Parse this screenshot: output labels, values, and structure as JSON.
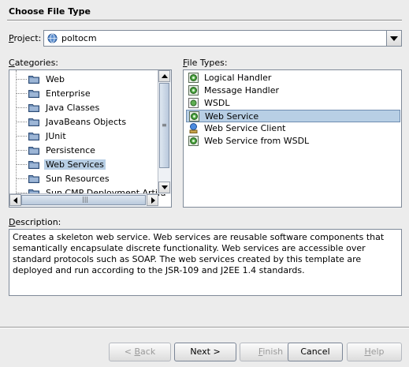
{
  "dialog": {
    "section_title": "Choose File Type"
  },
  "project": {
    "label_prefix": "",
    "label_underlined": "P",
    "label_rest": "roject:",
    "value": "poltocm"
  },
  "categories": {
    "label_underlined": "C",
    "label_rest": "ategories:",
    "items": [
      {
        "label": "Web"
      },
      {
        "label": "Enterprise"
      },
      {
        "label": "Java Classes"
      },
      {
        "label": "JavaBeans Objects"
      },
      {
        "label": "JUnit"
      },
      {
        "label": "Persistence"
      },
      {
        "label": "Web Services"
      },
      {
        "label": "Sun Resources"
      },
      {
        "label": "Sun CMP Deployment Artifa"
      }
    ],
    "selected": "Web Services"
  },
  "file_types": {
    "label_underlined": "F",
    "label_rest": "ile Types:",
    "items": [
      {
        "label": "Logical Handler",
        "icon": "handler-icon"
      },
      {
        "label": "Message Handler",
        "icon": "handler-icon"
      },
      {
        "label": "WSDL",
        "icon": "wsdl-icon"
      },
      {
        "label": "Web Service",
        "icon": "web-service-icon"
      },
      {
        "label": "Web Service Client",
        "icon": "web-service-client-icon"
      },
      {
        "label": "Web Service from WSDL",
        "icon": "web-service-icon"
      }
    ],
    "selected": "Web Service"
  },
  "description": {
    "label_underlined": "D",
    "label_rest": "escription:",
    "text": "Creates a skeleton web service. Web services are reusable software components that semantically encapsulate discrete functionality. Web services are accessible over standard protocols such as SOAP. The web services created by this template are deployed and run according to the JSR-109 and J2EE 1.4 standards."
  },
  "buttons": {
    "back": "< Back",
    "next": "Next >",
    "finish": "Finish",
    "cancel": "Cancel",
    "help": "Help"
  },
  "colors": {
    "selection": "#b8cfe5",
    "background": "#ececec"
  }
}
